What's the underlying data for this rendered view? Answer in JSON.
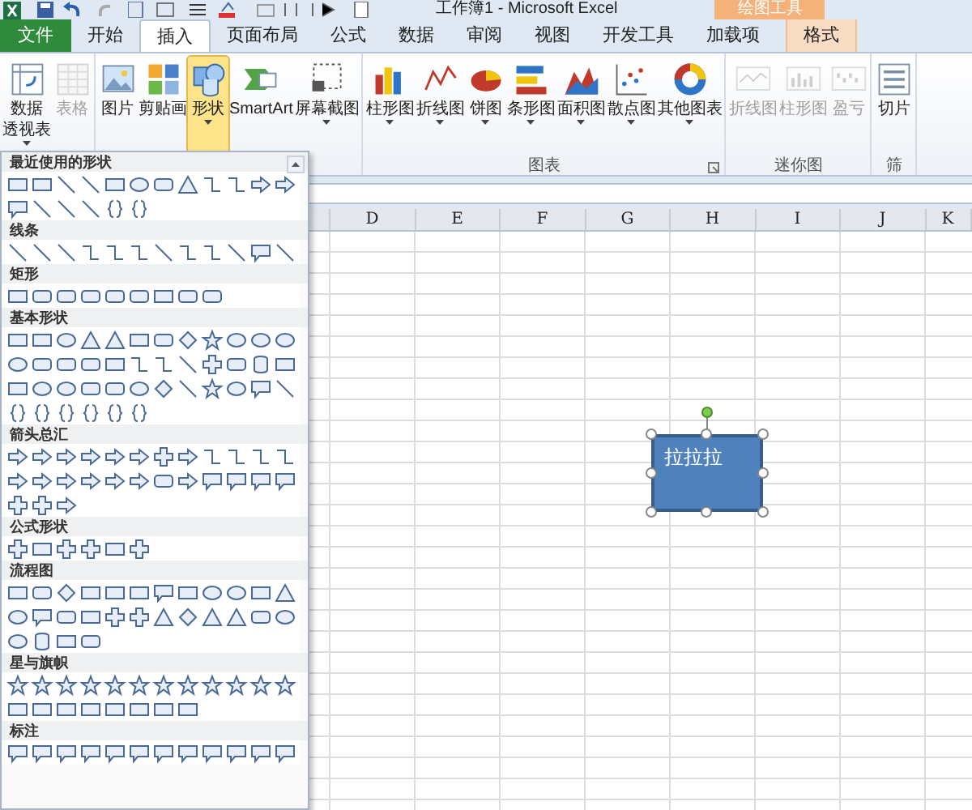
{
  "title_bar": {
    "title": "工作簿1 - Microsoft Excel",
    "context_label": "绘图工具"
  },
  "tabs": [
    {
      "label": "文件",
      "kind": "file",
      "selected": false
    },
    {
      "label": "开始",
      "kind": "normal",
      "selected": false
    },
    {
      "label": "插入",
      "kind": "normal",
      "selected": true
    },
    {
      "label": "页面布局",
      "kind": "normal",
      "selected": false
    },
    {
      "label": "公式",
      "kind": "normal",
      "selected": false
    },
    {
      "label": "数据",
      "kind": "normal",
      "selected": false
    },
    {
      "label": "审阅",
      "kind": "normal",
      "selected": false
    },
    {
      "label": "视图",
      "kind": "normal",
      "selected": false
    },
    {
      "label": "开发工具",
      "kind": "normal",
      "selected": false
    },
    {
      "label": "加载项",
      "kind": "normal",
      "selected": false
    },
    {
      "label": "格式",
      "kind": "context",
      "selected": false
    }
  ],
  "ribbon": {
    "groups": [
      {
        "buttons": [
          {
            "lines": [
              "数据",
              "透视表"
            ],
            "dropdown": true,
            "disabled": false,
            "selected": false
          },
          {
            "lines": [
              "表格"
            ],
            "dropdown": false,
            "disabled": true,
            "selected": false
          }
        ]
      },
      {
        "buttons": [
          {
            "lines": [
              "图片"
            ],
            "dropdown": false,
            "disabled": false,
            "selected": false
          },
          {
            "lines": [
              "剪贴画"
            ],
            "dropdown": false,
            "disabled": false,
            "selected": false
          },
          {
            "lines": [
              "形状"
            ],
            "dropdown": true,
            "disabled": false,
            "selected": true
          },
          {
            "lines": [
              "SmartArt"
            ],
            "dropdown": false,
            "disabled": false,
            "selected": false
          },
          {
            "lines": [
              "屏幕截图"
            ],
            "dropdown": true,
            "disabled": false,
            "selected": false
          }
        ]
      },
      {
        "label": "图表",
        "launcher": true,
        "buttons": [
          {
            "lines": [
              "柱形图"
            ],
            "dropdown": true,
            "disabled": false,
            "selected": false
          },
          {
            "lines": [
              "折线图"
            ],
            "dropdown": true,
            "disabled": false,
            "selected": false
          },
          {
            "lines": [
              "饼图"
            ],
            "dropdown": true,
            "disabled": false,
            "selected": false
          },
          {
            "lines": [
              "条形图"
            ],
            "dropdown": true,
            "disabled": false,
            "selected": false
          },
          {
            "lines": [
              "面积图"
            ],
            "dropdown": true,
            "disabled": false,
            "selected": false
          },
          {
            "lines": [
              "散点图"
            ],
            "dropdown": true,
            "disabled": false,
            "selected": false
          },
          {
            "lines": [
              "其他图表"
            ],
            "dropdown": true,
            "disabled": false,
            "selected": false
          }
        ]
      },
      {
        "label": "迷你图",
        "launcher": false,
        "buttons": [
          {
            "lines": [
              "折线图"
            ],
            "dropdown": false,
            "disabled": true,
            "selected": false
          },
          {
            "lines": [
              "柱形图"
            ],
            "dropdown": false,
            "disabled": true,
            "selected": false
          },
          {
            "lines": [
              "盈亏"
            ],
            "dropdown": false,
            "disabled": true,
            "selected": false
          }
        ]
      },
      {
        "label": "筛",
        "launcher": false,
        "buttons": [
          {
            "lines": [
              "切片"
            ],
            "dropdown": false,
            "disabled": false,
            "selected": false
          }
        ]
      }
    ]
  },
  "columns": [
    "D",
    "E",
    "F",
    "G",
    "H",
    "I",
    "J",
    "K"
  ],
  "shape": {
    "text": "拉拉拉",
    "selected": true
  },
  "shape_gallery": {
    "sections": [
      {
        "title": "最近使用的形状"
      },
      {
        "title": "线条"
      },
      {
        "title": "矩形"
      },
      {
        "title": "基本形状"
      },
      {
        "title": "箭头总汇"
      },
      {
        "title": "公式形状"
      },
      {
        "title": "流程图"
      },
      {
        "title": "星与旗帜"
      },
      {
        "title": "标注"
      }
    ]
  }
}
